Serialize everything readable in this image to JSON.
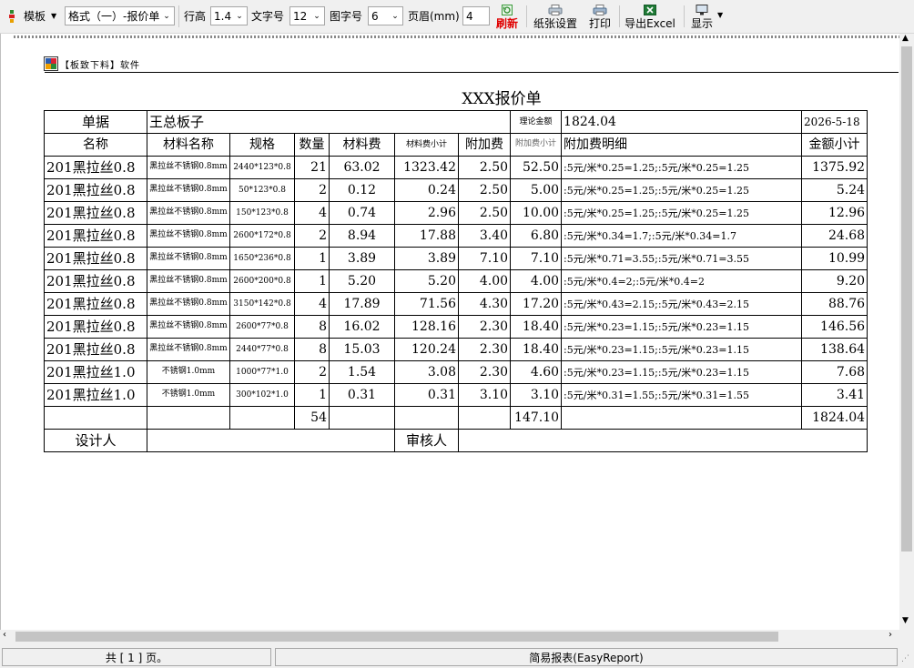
{
  "toolbar": {
    "template_label": "模板",
    "format_value": "格式（一）-报价单",
    "line_height_label": "行高",
    "line_height_value": "1.4",
    "font_size_label": "文字号",
    "font_size_value": "12",
    "image_size_label": "图字号",
    "image_size_value": "6",
    "header_label": "页眉(mm)",
    "header_value": "4",
    "refresh_label": "刷新",
    "paper_label": "纸张设置",
    "print_label": "打印",
    "excel_label": "导出Excel",
    "display_label": "显示"
  },
  "report": {
    "brand": "【板致下料】软件",
    "title": "XXX报价单",
    "doc_label": "单据",
    "doc_value": "王总板子",
    "theory_amount_label": "理论金额",
    "theory_amount_value": "1824.04",
    "date": "2026-5-18",
    "columns": [
      "名称",
      "材料名称",
      "规格",
      "数量",
      "材料费",
      "材料费小计",
      "附加费",
      "附加费小计",
      "附加费明细",
      "金额小计"
    ],
    "rows": [
      {
        "name": "201黑拉丝0.8",
        "mat": "黑拉丝不锈钢0.8mm",
        "spec": "2440*123*0.8",
        "qty": "21",
        "fee": "63.02",
        "sub": "1323.42",
        "add": "2.50",
        "addsub": "52.50",
        "detail": ":5元/米*0.25=1.25;:5元/米*0.25=1.25",
        "total": "1375.92"
      },
      {
        "name": "201黑拉丝0.8",
        "mat": "黑拉丝不锈钢0.8mm",
        "spec": "50*123*0.8",
        "qty": "2",
        "fee": "0.12",
        "sub": "0.24",
        "add": "2.50",
        "addsub": "5.00",
        "detail": ":5元/米*0.25=1.25;:5元/米*0.25=1.25",
        "total": "5.24"
      },
      {
        "name": "201黑拉丝0.8",
        "mat": "黑拉丝不锈钢0.8mm",
        "spec": "150*123*0.8",
        "qty": "4",
        "fee": "0.74",
        "sub": "2.96",
        "add": "2.50",
        "addsub": "10.00",
        "detail": ":5元/米*0.25=1.25;:5元/米*0.25=1.25",
        "total": "12.96"
      },
      {
        "name": "201黑拉丝0.8",
        "mat": "黑拉丝不锈钢0.8mm",
        "spec": "2600*172*0.8",
        "qty": "2",
        "fee": "8.94",
        "sub": "17.88",
        "add": "3.40",
        "addsub": "6.80",
        "detail": ":5元/米*0.34=1.7;:5元/米*0.34=1.7",
        "total": "24.68"
      },
      {
        "name": "201黑拉丝0.8",
        "mat": "黑拉丝不锈钢0.8mm",
        "spec": "1650*236*0.8",
        "qty": "1",
        "fee": "3.89",
        "sub": "3.89",
        "add": "7.10",
        "addsub": "7.10",
        "detail": ":5元/米*0.71=3.55;:5元/米*0.71=3.55",
        "total": "10.99"
      },
      {
        "name": "201黑拉丝0.8",
        "mat": "黑拉丝不锈钢0.8mm",
        "spec": "2600*200*0.8",
        "qty": "1",
        "fee": "5.20",
        "sub": "5.20",
        "add": "4.00",
        "addsub": "4.00",
        "detail": ":5元/米*0.4=2;:5元/米*0.4=2",
        "total": "9.20"
      },
      {
        "name": "201黑拉丝0.8",
        "mat": "黑拉丝不锈钢0.8mm",
        "spec": "3150*142*0.8",
        "qty": "4",
        "fee": "17.89",
        "sub": "71.56",
        "add": "4.30",
        "addsub": "17.20",
        "detail": ":5元/米*0.43=2.15;:5元/米*0.43=2.15",
        "total": "88.76"
      },
      {
        "name": "201黑拉丝0.8",
        "mat": "黑拉丝不锈钢0.8mm",
        "spec": "2600*77*0.8",
        "qty": "8",
        "fee": "16.02",
        "sub": "128.16",
        "add": "2.30",
        "addsub": "18.40",
        "detail": ":5元/米*0.23=1.15;:5元/米*0.23=1.15",
        "total": "146.56"
      },
      {
        "name": "201黑拉丝0.8",
        "mat": "黑拉丝不锈钢0.8mm",
        "spec": "2440*77*0.8",
        "qty": "8",
        "fee": "15.03",
        "sub": "120.24",
        "add": "2.30",
        "addsub": "18.40",
        "detail": ":5元/米*0.23=1.15;:5元/米*0.23=1.15",
        "total": "138.64"
      },
      {
        "name": "201黑拉丝1.0",
        "mat": "不锈钢1.0mm",
        "spec": "1000*77*1.0",
        "qty": "2",
        "fee": "1.54",
        "sub": "3.08",
        "add": "2.30",
        "addsub": "4.60",
        "detail": ":5元/米*0.23=1.15;:5元/米*0.23=1.15",
        "total": "7.68"
      },
      {
        "name": "201黑拉丝1.0",
        "mat": "不锈钢1.0mm",
        "spec": "300*102*1.0",
        "qty": "1",
        "fee": "0.31",
        "sub": "0.31",
        "add": "3.10",
        "addsub": "3.10",
        "detail": ":5元/米*0.31=1.55;:5元/米*0.31=1.55",
        "total": "3.41"
      }
    ],
    "sum_qty": "54",
    "sum_addsub": "147.10",
    "sum_total": "1824.04",
    "designer_label": "设计人",
    "reviewer_label": "审核人"
  },
  "status": {
    "pages": "共 [ 1 ] 页。",
    "app": "简易报表(EasyReport)"
  },
  "icons": {
    "template": "template-icon",
    "refresh": "refresh-icon",
    "paper": "printer-settings-icon",
    "print": "printer-icon",
    "excel": "excel-icon",
    "display": "monitor-icon"
  }
}
